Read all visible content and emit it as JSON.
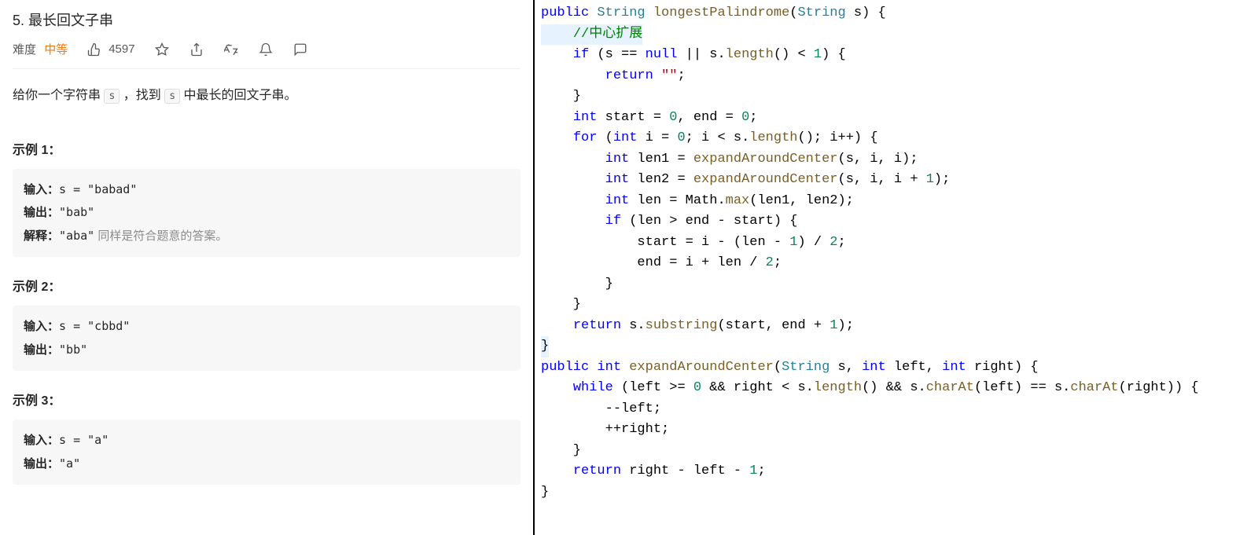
{
  "problem": {
    "title": "5. 最长回文子串",
    "difficulty_label": "难度",
    "difficulty_value": "中等",
    "likes": "4597",
    "description_prefix": "给你一个字符串 ",
    "description_code1": "s",
    "description_mid": " ，找到 ",
    "description_code2": "s",
    "description_suffix": " 中最长的回文子串。"
  },
  "examples": [
    {
      "title": "示例 1：",
      "input_label": "输入：",
      "input_value": "s = \"babad\"",
      "output_label": "输出：",
      "output_value": "\"bab\"",
      "explain_label": "解释：",
      "explain_value_mono": "\"aba\"",
      "explain_value_text": " 同样是符合题意的答案。"
    },
    {
      "title": "示例 2：",
      "input_label": "输入：",
      "input_value": "s = \"cbbd\"",
      "output_label": "输出：",
      "output_value": "\"bb\""
    },
    {
      "title": "示例 3：",
      "input_label": "输入：",
      "input_value": "s = \"a\"",
      "output_label": "输出：",
      "output_value": "\"a\""
    }
  ],
  "code": {
    "lines": [
      [
        [
          "kw",
          "public"
        ],
        [
          "",
          " "
        ],
        [
          "type",
          "String"
        ],
        [
          "",
          " "
        ],
        [
          "fn",
          "longestPalindrome"
        ],
        [
          "",
          "("
        ],
        [
          "type",
          "String"
        ],
        [
          "",
          " s) {"
        ]
      ],
      [
        [
          "",
          "    "
        ],
        [
          "cmt",
          "//中心扩展"
        ]
      ],
      [
        [
          "",
          "    "
        ],
        [
          "kw",
          "if"
        ],
        [
          "",
          " (s == "
        ],
        [
          "kw",
          "null"
        ],
        [
          "",
          " || s."
        ],
        [
          "fn",
          "length"
        ],
        [
          "",
          "() < "
        ],
        [
          "num",
          "1"
        ],
        [
          "",
          ") {"
        ]
      ],
      [
        [
          "",
          "        "
        ],
        [
          "kw",
          "return"
        ],
        [
          "",
          " "
        ],
        [
          "str",
          "\"\""
        ],
        [
          "",
          ";"
        ]
      ],
      [
        [
          "",
          "    }"
        ]
      ],
      [
        [
          "",
          "    "
        ],
        [
          "kw",
          "int"
        ],
        [
          "",
          " start = "
        ],
        [
          "num",
          "0"
        ],
        [
          "",
          ", end = "
        ],
        [
          "num",
          "0"
        ],
        [
          "",
          ";"
        ]
      ],
      [
        [
          "",
          "    "
        ],
        [
          "kw",
          "for"
        ],
        [
          "",
          " ("
        ],
        [
          "kw",
          "int"
        ],
        [
          "",
          " i = "
        ],
        [
          "num",
          "0"
        ],
        [
          "",
          "; i < s."
        ],
        [
          "fn",
          "length"
        ],
        [
          "",
          "(); i++) {"
        ]
      ],
      [
        [
          "",
          "        "
        ],
        [
          "kw",
          "int"
        ],
        [
          "",
          " len1 = "
        ],
        [
          "fn",
          "expandAroundCenter"
        ],
        [
          "",
          "(s, i, i);"
        ]
      ],
      [
        [
          "",
          "        "
        ],
        [
          "kw",
          "int"
        ],
        [
          "",
          " len2 = "
        ],
        [
          "fn",
          "expandAroundCenter"
        ],
        [
          "",
          "(s, i, i + "
        ],
        [
          "num",
          "1"
        ],
        [
          "",
          ");"
        ]
      ],
      [
        [
          "",
          "        "
        ],
        [
          "kw",
          "int"
        ],
        [
          "",
          " len = Math."
        ],
        [
          "fn",
          "max"
        ],
        [
          "",
          "(len1, len2);"
        ]
      ],
      [
        [
          "",
          "        "
        ],
        [
          "kw",
          "if"
        ],
        [
          "",
          " (len > end - start) {"
        ]
      ],
      [
        [
          "",
          "            start = i - (len - "
        ],
        [
          "num",
          "1"
        ],
        [
          "",
          ") / "
        ],
        [
          "num",
          "2"
        ],
        [
          "",
          ";"
        ]
      ],
      [
        [
          "",
          "            end = i + len / "
        ],
        [
          "num",
          "2"
        ],
        [
          "",
          ";"
        ]
      ],
      [
        [
          "",
          "        }"
        ]
      ],
      [
        [
          "",
          "    }"
        ]
      ],
      [
        [
          "",
          "    "
        ],
        [
          "kw",
          "return"
        ],
        [
          "",
          " s."
        ],
        [
          "fn",
          "substring"
        ],
        [
          "",
          "(start, end + "
        ],
        [
          "num",
          "1"
        ],
        [
          "",
          ");"
        ]
      ],
      [
        [
          "",
          "}"
        ]
      ],
      [
        [
          "kw",
          "public"
        ],
        [
          "",
          " "
        ],
        [
          "kw",
          "int"
        ],
        [
          "",
          " "
        ],
        [
          "fn",
          "expandAroundCenter"
        ],
        [
          "",
          "("
        ],
        [
          "type",
          "String"
        ],
        [
          "",
          " s, "
        ],
        [
          "kw",
          "int"
        ],
        [
          "",
          " left, "
        ],
        [
          "kw",
          "int"
        ],
        [
          "",
          " right) {"
        ]
      ],
      [
        [
          "",
          "    "
        ],
        [
          "kw",
          "while"
        ],
        [
          "",
          " (left >= "
        ],
        [
          "num",
          "0"
        ],
        [
          "",
          " && right < s."
        ],
        [
          "fn",
          "length"
        ],
        [
          "",
          "() && s."
        ],
        [
          "fn",
          "charAt"
        ],
        [
          "",
          "(left) == s."
        ],
        [
          "fn",
          "charAt"
        ],
        [
          "",
          "(right)) {"
        ]
      ],
      [
        [
          "",
          "        --left;"
        ]
      ],
      [
        [
          "",
          "        ++right;"
        ]
      ],
      [
        [
          "",
          "    }"
        ]
      ],
      [
        [
          "",
          "    "
        ],
        [
          "kw",
          "return"
        ],
        [
          "",
          " right - left - "
        ],
        [
          "num",
          "1"
        ],
        [
          "",
          ";"
        ]
      ],
      [
        [
          "",
          "}"
        ]
      ]
    ]
  }
}
